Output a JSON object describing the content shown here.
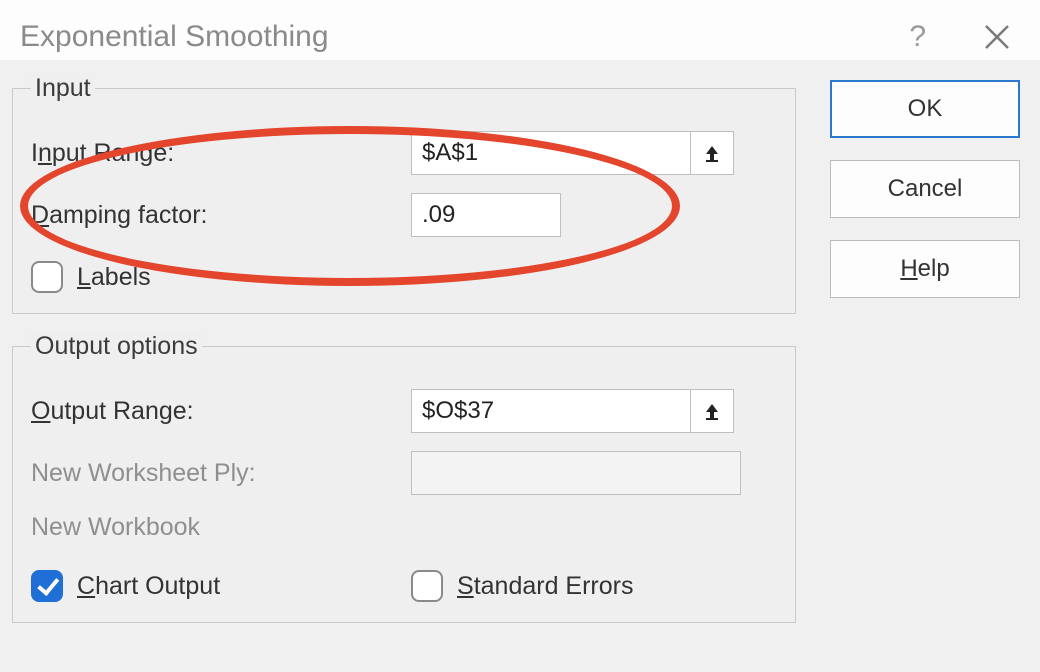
{
  "title": "Exponential Smoothing",
  "groups": {
    "input": {
      "legend": "Input",
      "input_range_label_pre": "I",
      "input_range_label_u": "n",
      "input_range_label_post": "put Range:",
      "input_range_value": "$A$1",
      "damping_label_u": "D",
      "damping_label_post": "amping factor:",
      "damping_value": ".09",
      "labels_u": "L",
      "labels_post": "abels"
    },
    "output": {
      "legend": "Output options",
      "output_range_u": "O",
      "output_range_post": "utput Range:",
      "output_range_value": "$O$37",
      "new_ws_label": "New Worksheet Ply:",
      "new_wb_label": "New Workbook",
      "chart_u": "C",
      "chart_post": "hart Output",
      "stderr_u": "S",
      "stderr_post": "tandard Errors"
    }
  },
  "buttons": {
    "ok": "OK",
    "cancel": "Cancel",
    "help_u": "H",
    "help_post": "elp"
  }
}
